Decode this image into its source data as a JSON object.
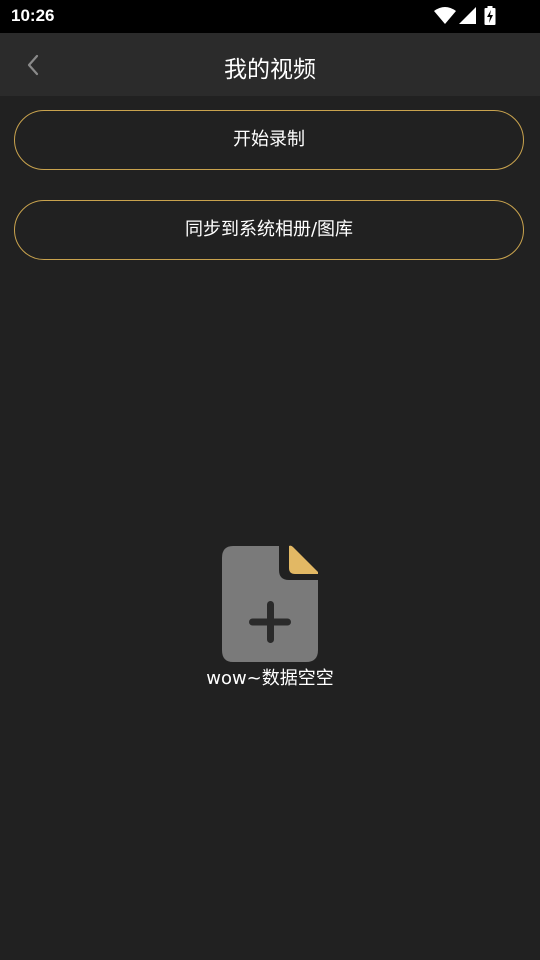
{
  "status_bar": {
    "time": "10:26",
    "icons": [
      "wifi-icon",
      "cellular-signal-icon",
      "battery-charging-icon"
    ]
  },
  "app_bar": {
    "back_icon": "chevron-left-icon",
    "title": "我的视频"
  },
  "actions": {
    "record_label": "开始录制",
    "sync_label": "同步到系统相册/图库"
  },
  "empty_state": {
    "icon": "add-file-icon",
    "message": "wow~数据空空"
  },
  "colors": {
    "background": "#212121",
    "app_bar": "#2b2b2b",
    "accent": "#c9a34e",
    "icon_body": "#7a7a7a",
    "icon_corner": "#e2b864"
  }
}
